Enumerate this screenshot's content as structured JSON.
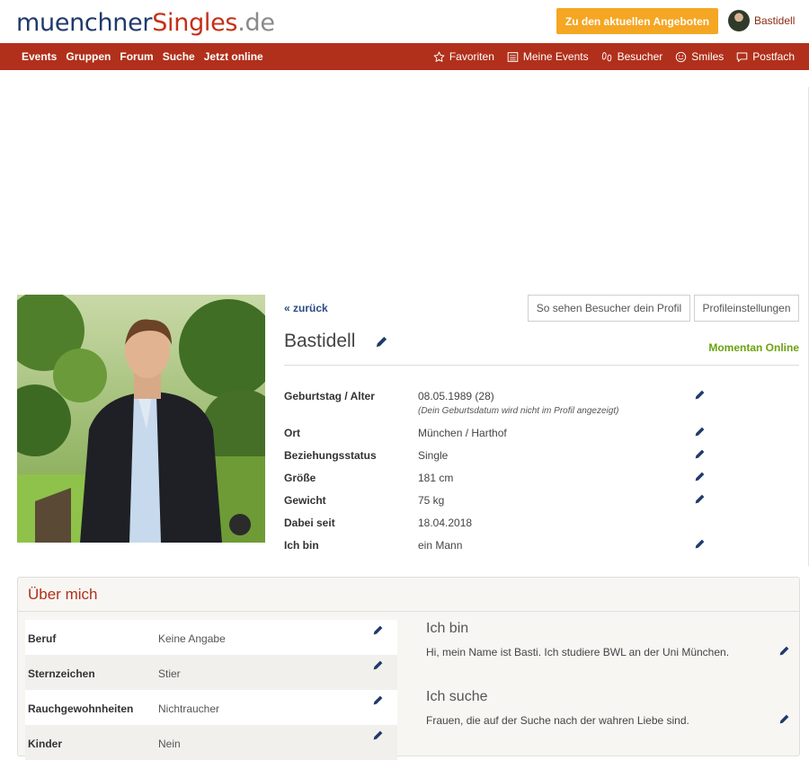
{
  "header": {
    "logo": {
      "part1": "muenchner",
      "part2": "Singles",
      "part3": ".de"
    },
    "offers_button": "Zu den aktuellen Angeboten",
    "username": "Bastidell"
  },
  "nav": {
    "left": [
      "Events",
      "Gruppen",
      "Forum",
      "Suche",
      "Jetzt online"
    ],
    "right": [
      {
        "label": "Favoriten",
        "icon": "star-icon"
      },
      {
        "label": "Meine Events",
        "icon": "calendar-list-icon"
      },
      {
        "label": "Besucher",
        "icon": "footprints-icon"
      },
      {
        "label": "Smiles",
        "icon": "smiley-icon"
      },
      {
        "label": "Postfach",
        "icon": "message-icon"
      }
    ]
  },
  "profile": {
    "back_link": "« zurück",
    "visitor_view_button": "So sehen Besucher dein Profil",
    "settings_button": "Profileinstellungen",
    "name": "Bastidell",
    "online_status": "Momentan Online",
    "facts": [
      {
        "label": "Geburtstag / Alter",
        "value": "08.05.1989 (28)",
        "note": "(Dein Geburtsdatum wird nicht im Profil angezeigt)",
        "editable": true
      },
      {
        "label": "Ort",
        "value": "München / Harthof",
        "editable": true
      },
      {
        "label": "Beziehungsstatus",
        "value": "Single",
        "editable": true
      },
      {
        "label": "Größe",
        "value": "181 cm",
        "editable": true
      },
      {
        "label": "Gewicht",
        "value": "75 kg",
        "editable": true
      },
      {
        "label": "Dabei seit",
        "value": "18.04.2018",
        "editable": false
      },
      {
        "label": "Ich bin",
        "value": "ein Mann",
        "editable": true
      }
    ]
  },
  "about": {
    "title": "Über mich",
    "rows": [
      {
        "label": "Beruf",
        "value": "Keine Angabe"
      },
      {
        "label": "Sternzeichen",
        "value": "Stier"
      },
      {
        "label": "Rauchgewohnheiten",
        "value": "Nichtraucher"
      },
      {
        "label": "Kinder",
        "value": "Nein"
      }
    ],
    "ich_bin": {
      "title": "Ich bin",
      "text": "Hi, mein Name ist Basti. Ich studiere BWL an der Uni München."
    },
    "ich_suche": {
      "title": "Ich suche",
      "text": "Frauen, die auf der Suche nach der wahren Liebe sind."
    }
  },
  "colors": {
    "brand_red": "#b1301b",
    "logo_blue": "#1f3a6b",
    "accent_orange": "#f5a623",
    "online_green": "#6ca20f",
    "link_blue": "#2a4c85"
  }
}
